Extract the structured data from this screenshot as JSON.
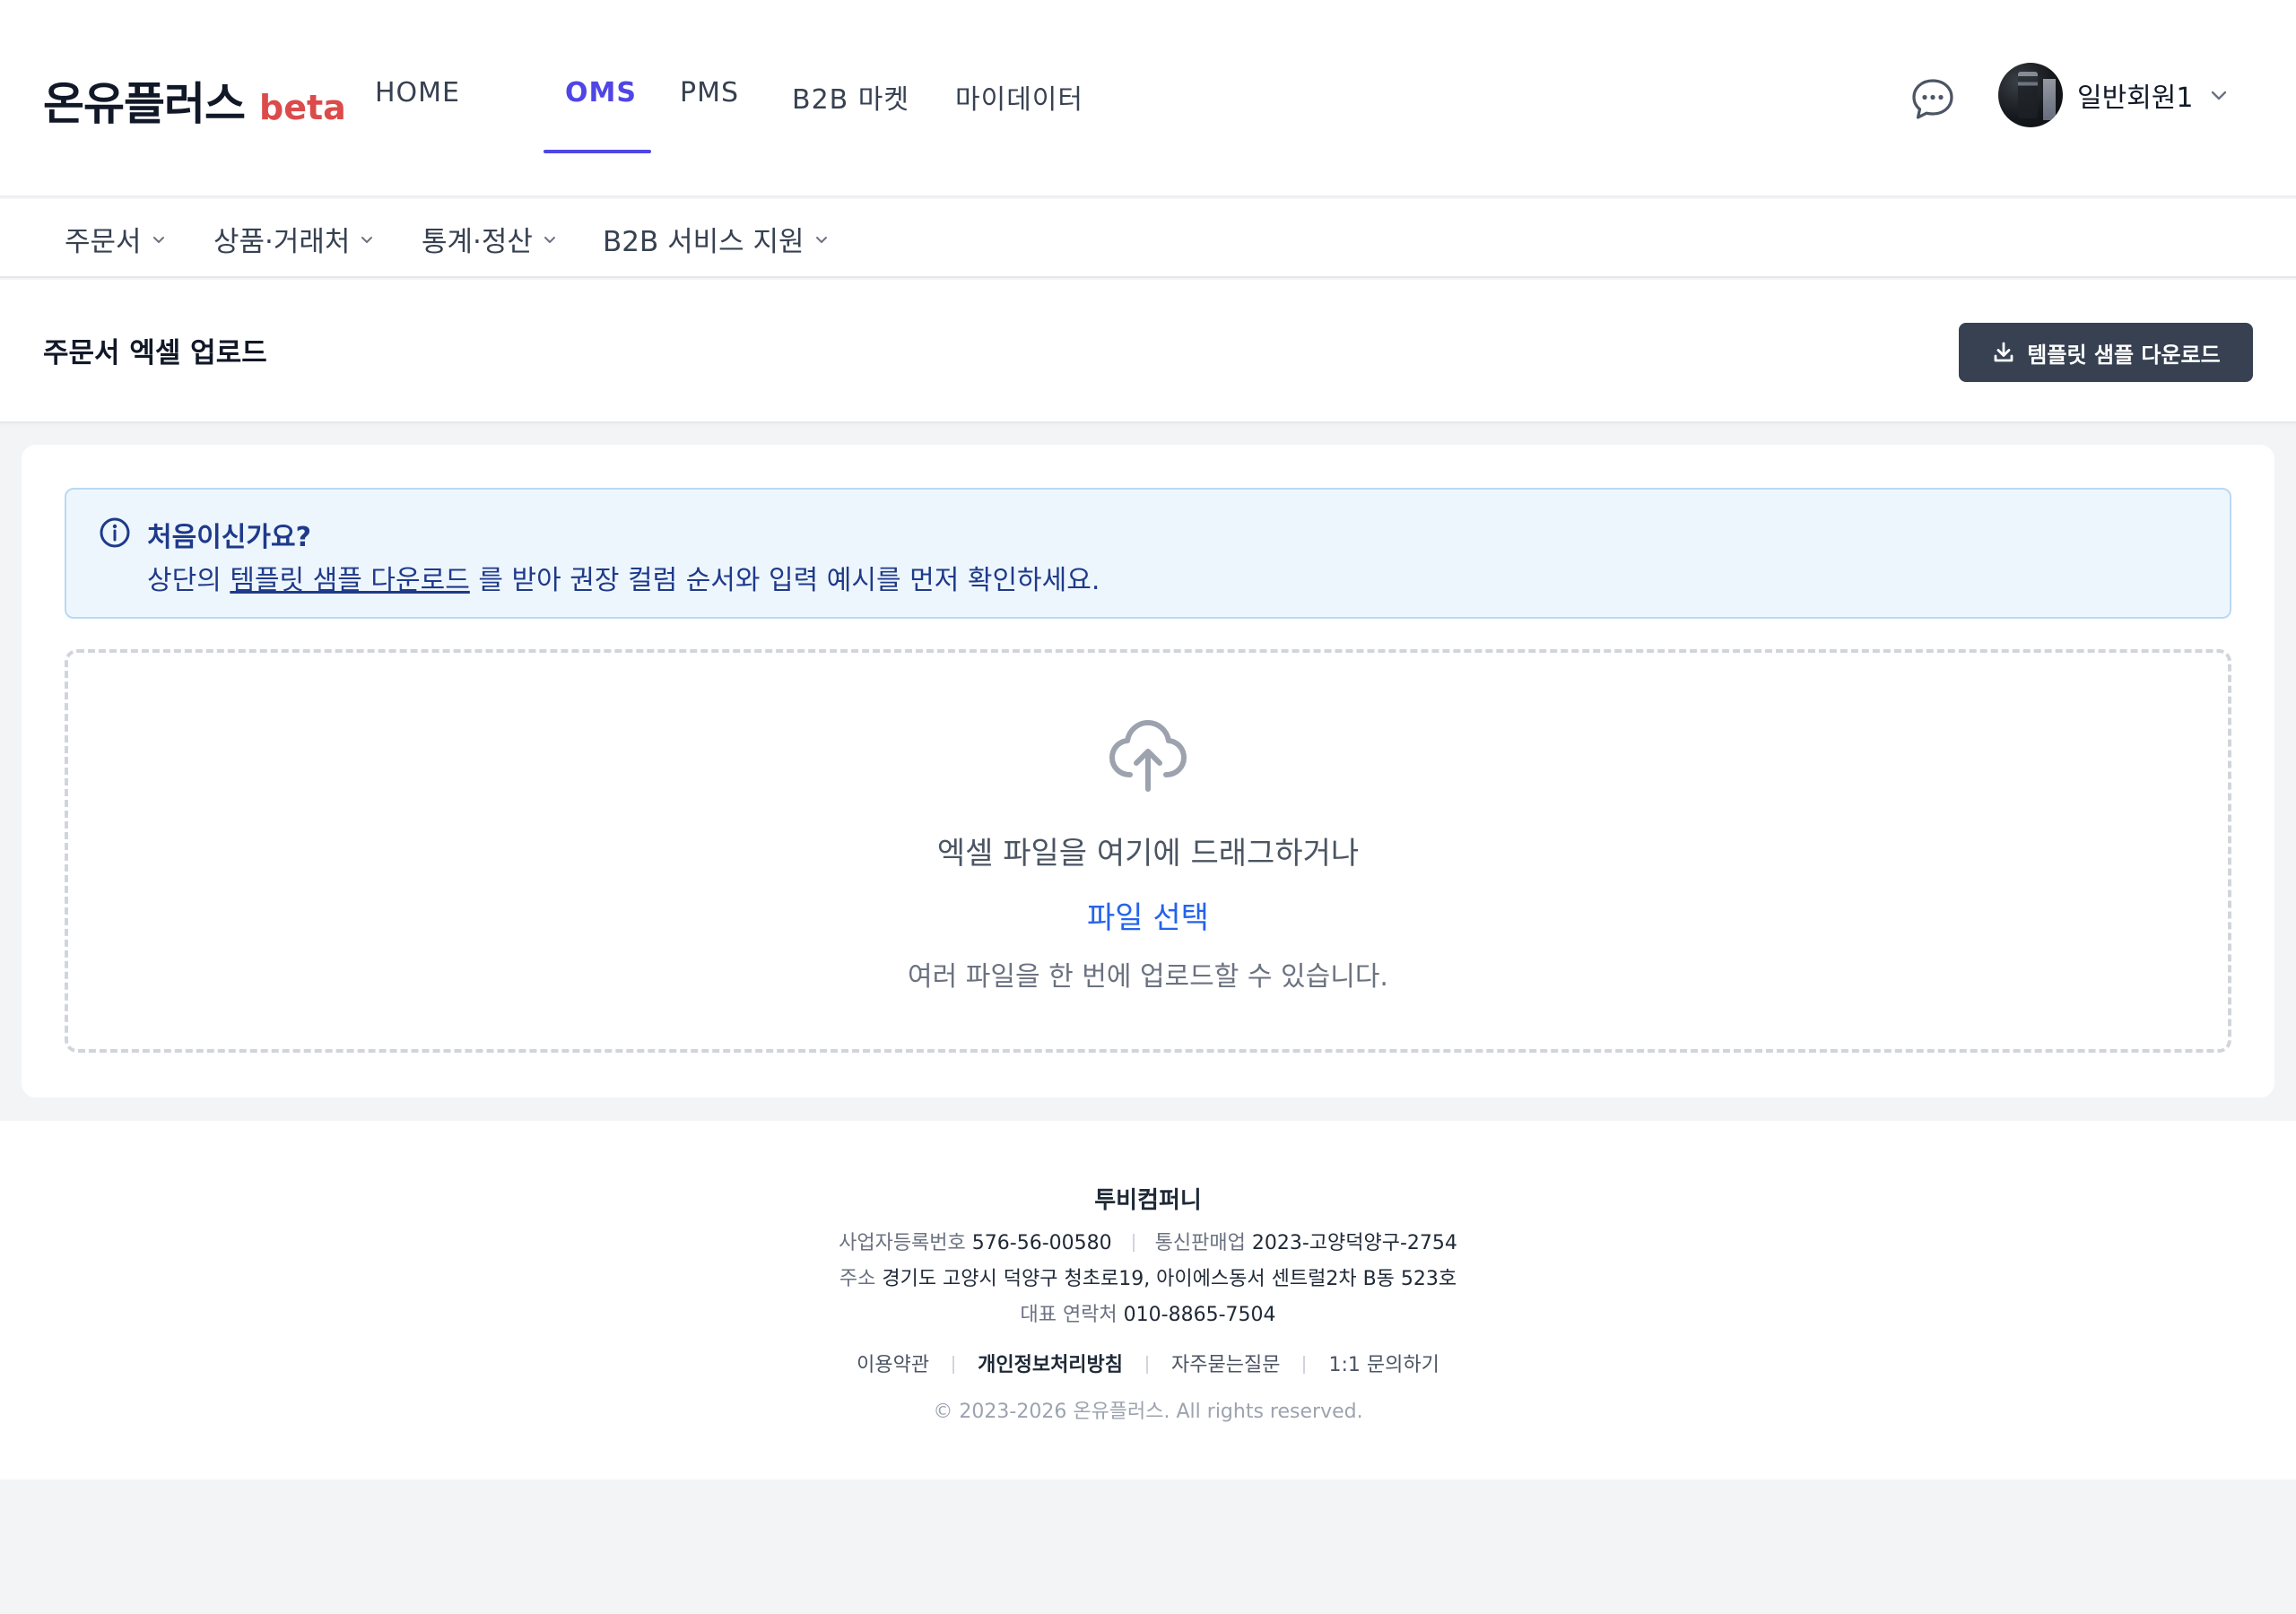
{
  "brand": {
    "name": "온유플러스",
    "tag": "beta"
  },
  "main_nav": [
    {
      "label": "HOME",
      "active": false
    },
    {
      "label": "OMS",
      "active": true
    },
    {
      "label": "PMS",
      "active": false
    },
    {
      "label": "B2B 마켓",
      "active": false
    },
    {
      "label": "마이데이터",
      "active": false
    }
  ],
  "user": {
    "name": "일반회원1"
  },
  "sub_nav": [
    {
      "label": "주문서"
    },
    {
      "label": "상품·거래처"
    },
    {
      "label": "통계·정산"
    },
    {
      "label": "B2B 서비스 지원"
    }
  ],
  "page": {
    "title": "주문서 엑셀 업로드",
    "template_button": "템플릿 샘플 다운로드"
  },
  "info": {
    "title": "처음이신가요?",
    "prefix": "상단의 ",
    "link": "템플릿 샘플 다운로드",
    "suffix": " 를 받아 권장 컬럼 순서와 입력 예시를 먼저 확인하세요."
  },
  "dropzone": {
    "main": "엑셀 파일을 여기에 드래그하거나",
    "select": "파일 선택",
    "hint": "여러 파일을 한 번에 업로드할 수 있습니다."
  },
  "footer": {
    "company": "투비컴퍼니",
    "biz_no_label": "사업자등록번호",
    "biz_no": "576-56-00580",
    "mail_order_label": "통신판매업",
    "mail_order": "2023-고양덕양구-2754",
    "address_label": "주소",
    "address": "경기도 고양시 덕양구 청초로19, 아이에스동서 센트럴2차 B동 523호",
    "phone_label": "대표 연락처",
    "phone": "010-8865-7504",
    "links": [
      "이용약관",
      "개인정보처리방침",
      "자주묻는질문",
      "1:1 문의하기"
    ],
    "copyright": "© 2023-2026 온유플러스. All rights reserved."
  },
  "colors": {
    "accent": "#4f46e5",
    "beta": "#dc4a4a",
    "button_bg": "#374151",
    "link_blue": "#2563eb",
    "info_bg": "#eef6fd"
  },
  "icons": {
    "chat": "chat-bubble-icon",
    "info": "info-icon",
    "upload": "cloud-upload-icon",
    "download": "download-icon",
    "chevron": "chevron-down-icon"
  }
}
